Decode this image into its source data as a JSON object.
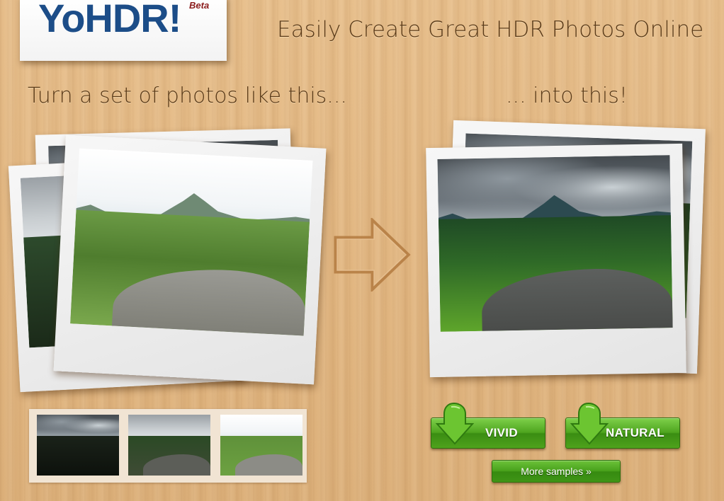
{
  "header": {
    "logo_text": "YoHDR!",
    "logo_badge": "Beta",
    "tagline": "Easily Create Great HDR Photos Online"
  },
  "before": {
    "heading": "Turn a set of photos like this..."
  },
  "after": {
    "heading": "... into this!"
  },
  "buttons": {
    "vivid_label": "VIVID",
    "natural_label": "NATURAL",
    "more_label": "More samples »"
  },
  "icons": {
    "transform_arrow": "right-arrow-icon",
    "download": "down-arrow-icon"
  },
  "colors": {
    "logo_blue": "#1c4d88",
    "beta_red": "#8b1a1a",
    "heading_brown": "#5a3a18",
    "button_green": "#4ea51f"
  }
}
